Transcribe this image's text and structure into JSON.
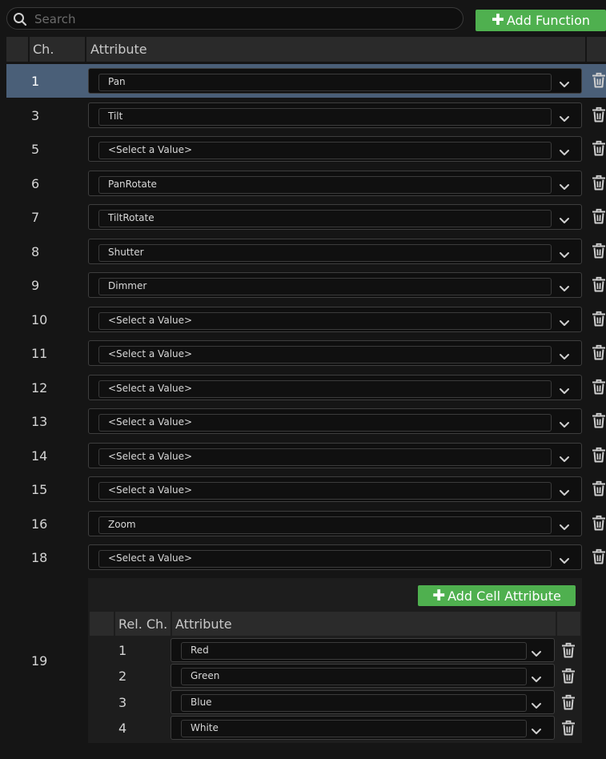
{
  "search": {
    "placeholder": "Search"
  },
  "toolbar": {
    "add_function_label": "Add Function"
  },
  "table": {
    "col_ch": "Ch.",
    "col_attribute": "Attribute",
    "rows": [
      {
        "ch": "1",
        "value": "Pan",
        "selected": true
      },
      {
        "ch": "3",
        "value": "Tilt"
      },
      {
        "ch": "5",
        "value": "<Select a Value>"
      },
      {
        "ch": "6",
        "value": "PanRotate"
      },
      {
        "ch": "7",
        "value": "TiltRotate"
      },
      {
        "ch": "8",
        "value": "Shutter"
      },
      {
        "ch": "9",
        "value": "Dimmer"
      },
      {
        "ch": "10",
        "value": "<Select a Value>"
      },
      {
        "ch": "11",
        "value": "<Select a Value>"
      },
      {
        "ch": "12",
        "value": "<Select a Value>"
      },
      {
        "ch": "13",
        "value": "<Select a Value>"
      },
      {
        "ch": "14",
        "value": "<Select a Value>"
      },
      {
        "ch": "15",
        "value": "<Select a Value>"
      },
      {
        "ch": "16",
        "value": "Zoom"
      },
      {
        "ch": "18",
        "value": "<Select a Value>"
      }
    ]
  },
  "cell": {
    "ch": "19",
    "add_label": "Add Cell Attribute",
    "col_rel_ch": "Rel. Ch.",
    "col_attribute": "Attribute",
    "rows": [
      {
        "rel": "1",
        "value": "Red"
      },
      {
        "rel": "2",
        "value": "Green"
      },
      {
        "rel": "3",
        "value": "Blue"
      },
      {
        "rel": "4",
        "value": "White"
      }
    ]
  },
  "colors": {
    "accent_green": "#4fb04f",
    "selection": "#4a5f78",
    "background": "#151515"
  }
}
